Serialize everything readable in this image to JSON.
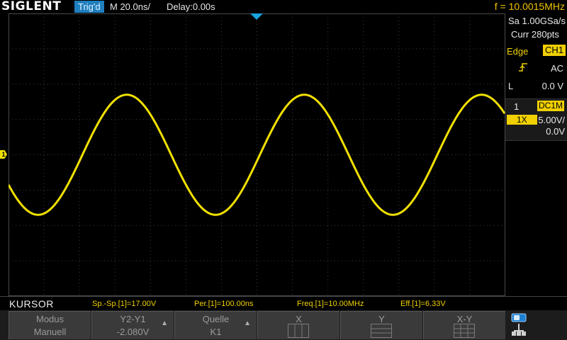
{
  "header": {
    "logo": "SIGLENT",
    "trigger_status": "Trig'd",
    "timebase": "M 20.0ns/",
    "delay": "Delay:0.00s",
    "frequency": "f = 10.0015MHz"
  },
  "acquisition": {
    "sample_rate": "Sa 1.00GSa/s",
    "memory": "Curr 280pts"
  },
  "trigger": {
    "type": "Edge",
    "source": "CH1",
    "coupling": "AC",
    "level_label": "L",
    "level": "0.0 V"
  },
  "channel": {
    "number": "1",
    "coupling": "DC1M",
    "probe": "1X",
    "vdiv": "5.00V/",
    "offset": "0.0V",
    "marker": "1"
  },
  "measurement_bar": {
    "mode": "KURSOR",
    "items": [
      "Sp.-Sp.[1]=17.00V",
      "Per.[1]=100.00ns",
      "Freq.[1]=10.00MHz",
      "Eff.[1]=6.33V"
    ]
  },
  "softkeys": [
    {
      "line1": "Modus",
      "line2": "Manuell"
    },
    {
      "line1": "Y2-Y1",
      "line2": "-2.080V"
    },
    {
      "line1": "Quelle",
      "line2": "K1"
    },
    {
      "line1": "X",
      "line2": ""
    },
    {
      "line1": "Y",
      "line2": ""
    },
    {
      "line1": "X-Y",
      "line2": ""
    }
  ],
  "icons": {
    "trigger_position": "trigger-position-marker-icon",
    "edge_slope": "rising-edge-icon",
    "network": "network-icon"
  },
  "colors": {
    "channel1": "#f0e000",
    "trigger_accent": "#1aa3e0",
    "frequency": "#f0c200"
  },
  "waveform": {
    "channel": "CH1",
    "shape": "sine",
    "volts_per_div": 5.0,
    "peak_to_peak_v": 17.0,
    "offset_v": 0.0,
    "period_ns": 100.0,
    "time_per_div_ns": 20.0,
    "h_divisions": 14,
    "v_divisions": 8,
    "trigger_time_ns": 0.0,
    "start_phase_deg": 210
  }
}
